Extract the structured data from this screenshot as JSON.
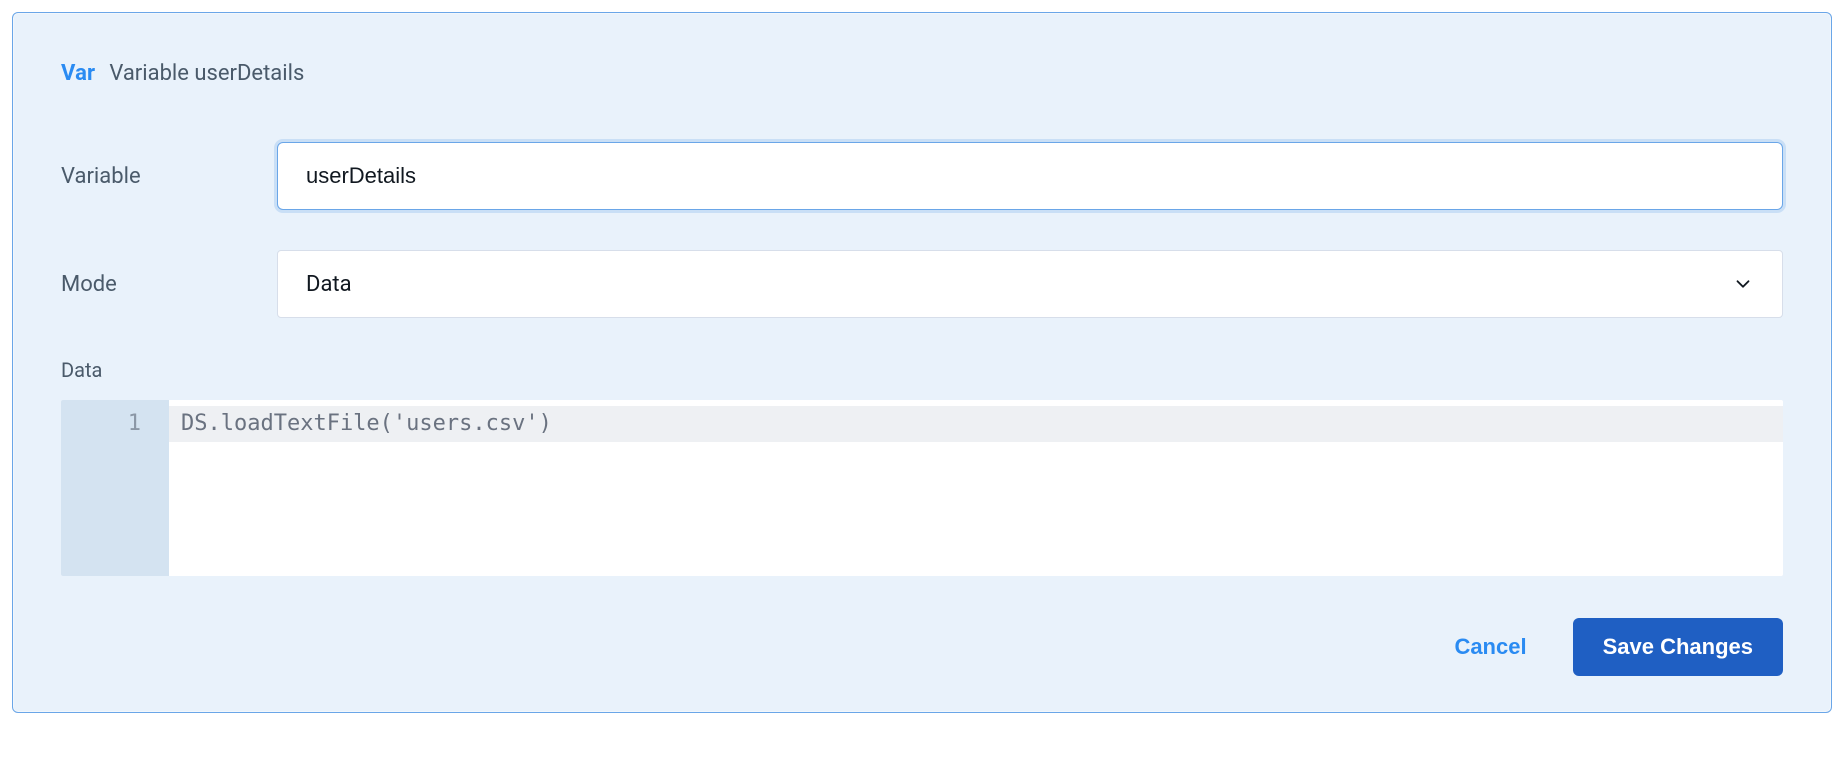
{
  "header": {
    "badge": "Var",
    "title": "Variable userDetails"
  },
  "form": {
    "variable": {
      "label": "Variable",
      "value": "userDetails"
    },
    "mode": {
      "label": "Mode",
      "value": "Data"
    },
    "data": {
      "label": "Data",
      "lines": {
        "1": "DS.loadTextFile('users.csv')"
      },
      "line_number_1": "1"
    }
  },
  "actions": {
    "cancel": "Cancel",
    "save": "Save Changes"
  }
}
